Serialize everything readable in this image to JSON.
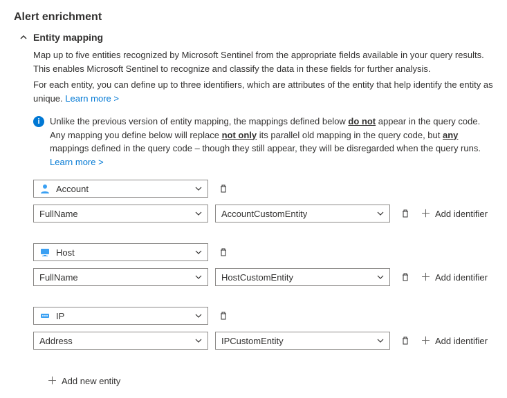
{
  "title": "Alert enrichment",
  "section": {
    "label": "Entity mapping",
    "desc1": "Map up to five entities recognized by Microsoft Sentinel from the appropriate fields available in your query results. This enables Microsoft Sentinel to recognize and classify the data in these fields for further analysis.",
    "desc2": "For each entity, you can define up to three identifiers, which are attributes of the entity that help identify the entity as unique.",
    "learn_more": "Learn more >",
    "info_pre": "Unlike the previous version of entity mapping, the mappings defined below ",
    "info_b1": "do not",
    "info_mid1": " appear in the query code. Any mapping you define below will replace ",
    "info_b2": "not only",
    "info_mid2": " its parallel old mapping in the query code, but ",
    "info_b3": "any",
    "info_post": " mappings defined in the query code – though they still appear, they will be disregarded when the query runs. ",
    "info_learn": "Learn more >"
  },
  "entities": [
    {
      "type": "Account",
      "icon": "account-icon",
      "identifier": "FullName",
      "value": "AccountCustomEntity"
    },
    {
      "type": "Host",
      "icon": "host-icon",
      "identifier": "FullName",
      "value": "HostCustomEntity"
    },
    {
      "type": "IP",
      "icon": "ip-icon",
      "identifier": "Address",
      "value": "IPCustomEntity"
    }
  ],
  "labels": {
    "add_identifier": "Add identifier",
    "add_entity": "Add new entity"
  }
}
